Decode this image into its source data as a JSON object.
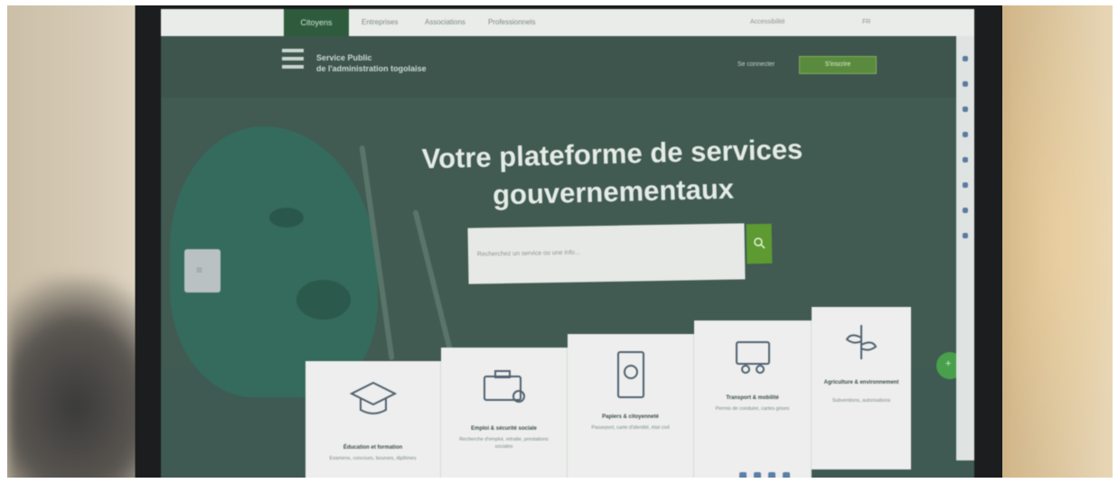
{
  "topbar": {
    "active_tab": "Citoyens",
    "tabs": [
      "Entreprises",
      "Associations",
      "Professionnels"
    ],
    "utility": "Accessibilité",
    "lang": "FR"
  },
  "header": {
    "org_line1": "Service Public",
    "org_line2": "de l'administration togolaise",
    "login": "Se connecter",
    "signup": "S'inscrire"
  },
  "hero": {
    "title": "Votre plateforme de services gouvernementaux",
    "search_placeholder": "Recherchez un service ou une info..."
  },
  "cards": [
    {
      "title": "Éducation et formation",
      "desc": "Examens, concours, bourses, diplômes",
      "icon": "graduation-cap-icon"
    },
    {
      "title": "Emploi & sécurité sociale",
      "desc": "Recherche d'emploi, retraite, prestations sociales",
      "icon": "briefcase-icon"
    },
    {
      "title": "Papiers & citoyenneté",
      "desc": "Passeport, carte d'identité, état civil",
      "icon": "passport-icon"
    },
    {
      "title": "Transport & mobilité",
      "desc": "Permis de conduire, cartes grises",
      "icon": "car-icon"
    },
    {
      "title": "Agriculture & environnement",
      "desc": "Subventions, autorisations",
      "icon": "plant-icon"
    }
  ],
  "colors": {
    "hero": "#415a52",
    "accent": "#5d9a32",
    "active_tab": "#2d5b3c",
    "card": "#edeeed"
  }
}
